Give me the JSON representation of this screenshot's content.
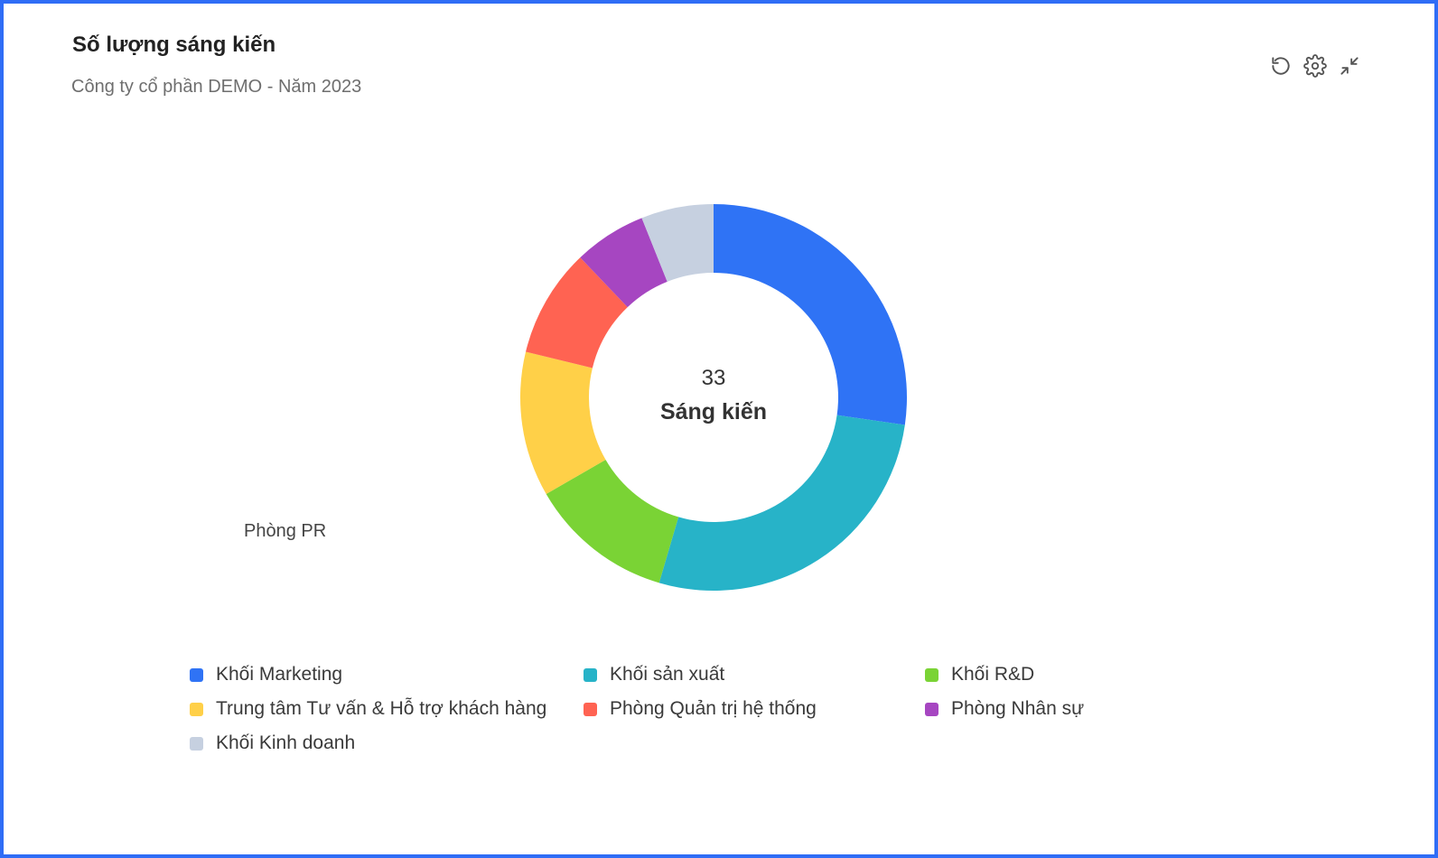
{
  "header": {
    "title": "Số lượng sáng kiến",
    "subtitle": "Công ty cổ phần DEMO - Năm 2023"
  },
  "toolbar": {
    "icons": [
      "reset-icon",
      "settings-icon",
      "collapse-icon"
    ]
  },
  "chart_data": {
    "type": "pie",
    "variant": "donut",
    "title": "Số lượng sáng kiến",
    "subtitle": "Công ty cổ phần DEMO - Năm 2023",
    "center": {
      "value": "33",
      "label": "Sáng kiến"
    },
    "total": 33,
    "slices": [
      {
        "name": "Khối Marketing",
        "value": 9,
        "color": "#2f73f5"
      },
      {
        "name": "Khối sản xuất",
        "value": 9,
        "color": "#27b3c8"
      },
      {
        "name": "Khối R&D",
        "value": 4,
        "color": "#7ad335"
      },
      {
        "name": "Trung tâm Tư vấn & Hỗ trợ khách hàng",
        "value": 4,
        "color": "#ffd048"
      },
      {
        "name": "Phòng Quản trị hệ thống",
        "value": 3,
        "color": "#ff6352"
      },
      {
        "name": "Phòng Nhân sự",
        "value": 2,
        "color": "#a646c1"
      },
      {
        "name": "Khối Kinh doanh",
        "value": 2,
        "color": "#c6d0e0"
      }
    ],
    "outside_labels": [
      "Phòng PR"
    ],
    "legend_position": "bottom"
  }
}
